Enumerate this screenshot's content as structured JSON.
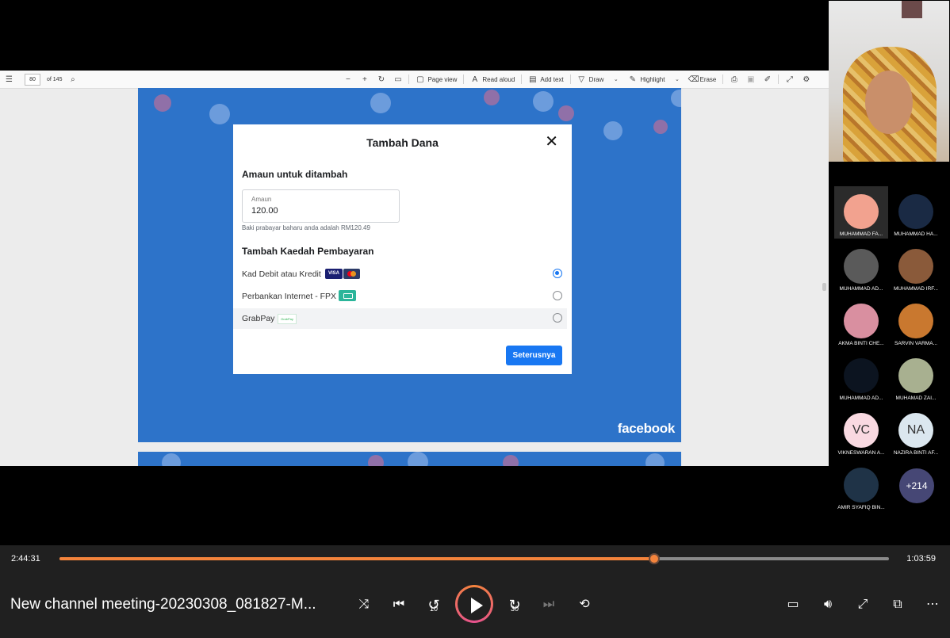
{
  "pdf_toolbar": {
    "page_number": "80",
    "page_total": "of 145",
    "page_view": "Page view",
    "read_aloud": "Read aloud",
    "add_text": "Add text",
    "draw": "Draw",
    "highlight": "Highlight",
    "erase": "Erase"
  },
  "dialog": {
    "title": "Tambah Dana",
    "close_glyph": "✕",
    "amount_heading": "Amaun untuk ditambah",
    "amount_label": "Amaun",
    "amount_value": "120.00",
    "balance_note": "Baki prabayar baharu anda adalah RM120.49",
    "method_heading": "Tambah Kaedah Pembayaran",
    "methods": [
      {
        "label": "Kad Debit atau Kredit",
        "selected": true
      },
      {
        "label": "Perbankan Internet - FPX",
        "selected": false
      },
      {
        "label": "GrabPay",
        "selected": false
      }
    ],
    "visa_text": "VISA",
    "grab_text": "GrabPay",
    "next_button": "Seterusnya"
  },
  "brand_logo": "facebook",
  "participants": [
    {
      "name": "MUHAMMAD FA...",
      "type": "photo",
      "color": "#f2a28f"
    },
    {
      "name": "MUHAMMAD HA...",
      "type": "photo",
      "color": "#1a2a44"
    },
    {
      "name": "MUHAMMAD AD...",
      "type": "photo",
      "color": "#5a5a5a"
    },
    {
      "name": "MUHAMMAD IRF...",
      "type": "photo",
      "color": "#8a5a3a"
    },
    {
      "name": "AKMA BINTI CHE...",
      "type": "photo",
      "color": "#d98fa0"
    },
    {
      "name": "SARVIN VARMA...",
      "type": "photo",
      "color": "#c9782f"
    },
    {
      "name": "MUHAMMAD AD...",
      "type": "photo",
      "color": "#0c1420"
    },
    {
      "name": "MUHAMAD ZAI...",
      "type": "photo",
      "color": "#a8b090"
    },
    {
      "name": "VIKNESWARAN A...",
      "type": "initials",
      "initials": "VC",
      "color": "#f9d9e1"
    },
    {
      "name": "NAZIRA BINTI AF...",
      "type": "initials",
      "initials": "NA",
      "color": "#dbe7ef"
    },
    {
      "name": "AMIR SYAFIQ BIN...",
      "type": "photo",
      "color": "#1f3347"
    }
  ],
  "more_participants": "+214",
  "player": {
    "elapsed": "2:44:31",
    "remaining": "1:03:59",
    "progress": 0.717,
    "title": "New channel meeting-20230308_081827-M...",
    "skip_back": "10",
    "skip_forward": "30"
  },
  "colors": {
    "accent": "#f4843c",
    "facebook_blue": "#2d73c9",
    "button_blue": "#1877f2"
  }
}
